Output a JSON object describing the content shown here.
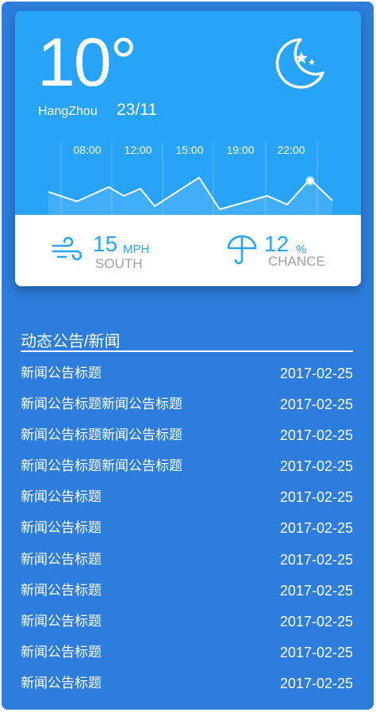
{
  "weather": {
    "temperature": "10°",
    "city": "HangZhou",
    "date": "23/11",
    "condition_icon": "moon-stars-icon",
    "hours": [
      "08:00",
      "12:00",
      "15:00",
      "19:00",
      "22:00"
    ],
    "wind": {
      "icon": "wind-icon",
      "value": "15",
      "unit": "MPH",
      "direction": "SOUTH"
    },
    "rain": {
      "icon": "umbrella-icon",
      "value": "12",
      "unit": "%",
      "label": "CHANCE"
    }
  },
  "news": {
    "title": "动态公告/新闻",
    "items": [
      {
        "headline": "新闻公告标题",
        "date": "2017-02-25"
      },
      {
        "headline": "新闻公告标题新闻公告标题",
        "date": "2017-02-25"
      },
      {
        "headline": "新闻公告标题新闻公告标题",
        "date": "2017-02-25"
      },
      {
        "headline": "新闻公告标题新闻公告标题",
        "date": "2017-02-25"
      },
      {
        "headline": "新闻公告标题",
        "date": "2017-02-25"
      },
      {
        "headline": "新闻公告标题",
        "date": "2017-02-25"
      },
      {
        "headline": "新闻公告标题",
        "date": "2017-02-25"
      },
      {
        "headline": "新闻公告标题",
        "date": "2017-02-25"
      },
      {
        "headline": "新闻公告标题",
        "date": "2017-02-25"
      },
      {
        "headline": "新闻公告标题",
        "date": "2017-02-25"
      },
      {
        "headline": "新闻公告标题",
        "date": "2017-02-25"
      }
    ]
  },
  "colors": {
    "panel": "#2c7ddc",
    "card_top": "#27a4f7",
    "accent": "#27a4f7",
    "muted": "#9aa3ab"
  }
}
